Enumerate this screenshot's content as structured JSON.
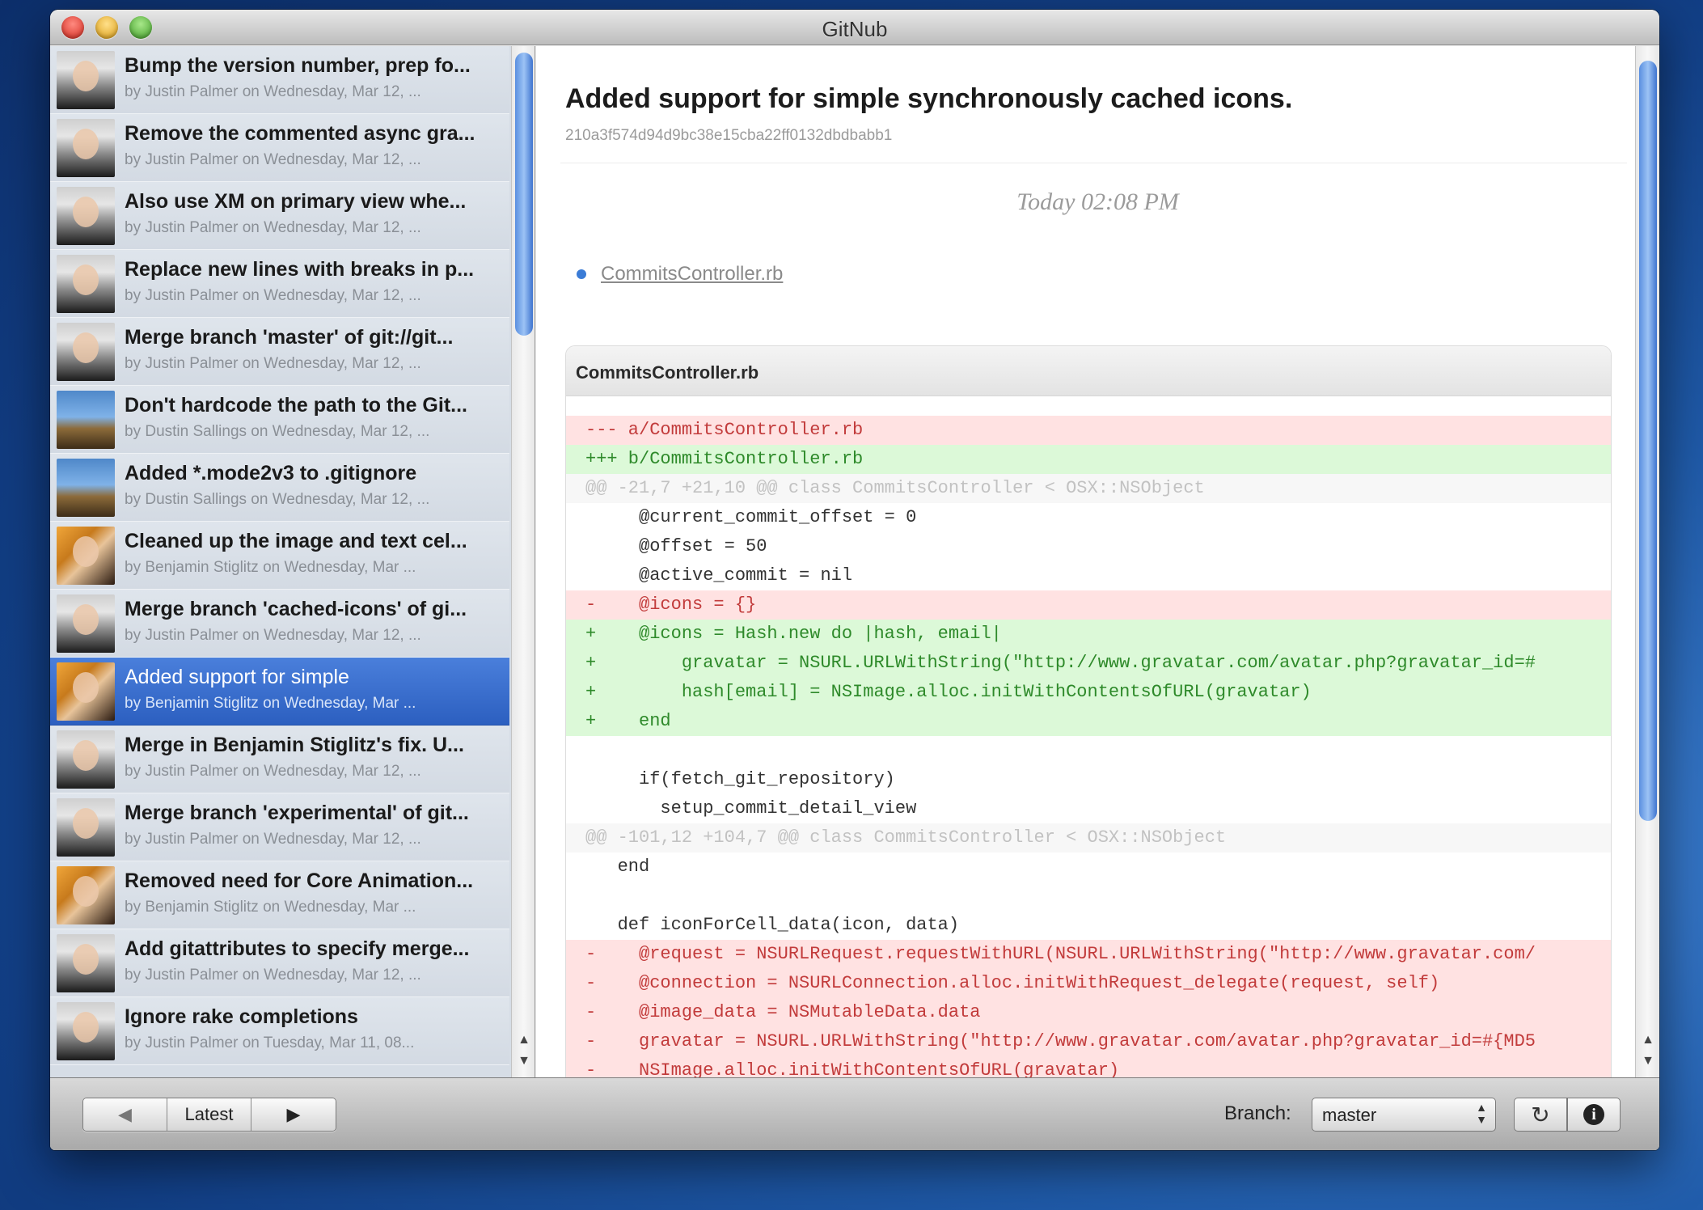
{
  "window": {
    "title": "GitNub"
  },
  "commits": [
    {
      "title": "Bump the version number, prep fo...",
      "sub": "by Justin Palmer on Wednesday, Mar 12, ...",
      "avatar": "justin"
    },
    {
      "title": "Remove the commented async gra...",
      "sub": "by Justin Palmer on Wednesday, Mar 12, ...",
      "avatar": "justin"
    },
    {
      "title": "Also use XM on primary view whe...",
      "sub": "by Justin Palmer on Wednesday, Mar 12, ...",
      "avatar": "justin"
    },
    {
      "title": "Replace new lines with breaks in p...",
      "sub": "by Justin Palmer on Wednesday, Mar 12, ...",
      "avatar": "justin"
    },
    {
      "title": "Merge branch 'master' of git://git...",
      "sub": "by Justin Palmer on Wednesday, Mar 12, ...",
      "avatar": "justin"
    },
    {
      "title": "Don't hardcode the path to the Git...",
      "sub": "by Dustin Sallings on Wednesday, Mar 12, ...",
      "avatar": "dustin"
    },
    {
      "title": "Added *.mode2v3 to .gitignore",
      "sub": "by Dustin Sallings on Wednesday, Mar 12, ...",
      "avatar": "dustin"
    },
    {
      "title": "Cleaned up the image and text cel...",
      "sub": "by Benjamin Stiglitz on Wednesday, Mar ...",
      "avatar": "benjamin"
    },
    {
      "title": "Merge branch 'cached-icons' of gi...",
      "sub": "by Justin Palmer on Wednesday, Mar 12, ...",
      "avatar": "justin"
    },
    {
      "title": "Added support for simple",
      "sub": "by Benjamin Stiglitz on Wednesday, Mar ...",
      "avatar": "benjamin",
      "selected": true
    },
    {
      "title": "Merge in Benjamin Stiglitz's fix. U...",
      "sub": "by Justin Palmer on Wednesday, Mar 12, ...",
      "avatar": "justin"
    },
    {
      "title": "Merge branch 'experimental' of git...",
      "sub": "by Justin Palmer on Wednesday, Mar 12, ...",
      "avatar": "justin"
    },
    {
      "title": "Removed need for Core Animation...",
      "sub": "by Benjamin Stiglitz on Wednesday, Mar ...",
      "avatar": "benjamin"
    },
    {
      "title": "Add gitattributes to specify merge...",
      "sub": "by Justin Palmer on Wednesday, Mar 12, ...",
      "avatar": "justin"
    },
    {
      "title": "Ignore rake completions",
      "sub": "by Justin Palmer on Tuesday, Mar 11, 08...",
      "avatar": "justin"
    }
  ],
  "detail": {
    "heading": "Added support for simple synchronously cached icons.",
    "sha": "210a3f574d94d9bc38e15cba22ff0132dbdbabb1",
    "date": "Today 02:08 PM",
    "file_link": "CommitsController.rb",
    "diff_header": "CommitsController.rb",
    "diff_lines": [
      {
        "type": "del",
        "text": "--- a/CommitsController.rb"
      },
      {
        "type": "add",
        "text": "+++ b/CommitsController.rb"
      },
      {
        "type": "hunk",
        "text": "@@ -21,7 +21,10 @@ class CommitsController < OSX::NSObject"
      },
      {
        "type": "ctx",
        "text": "     @current_commit_offset = 0"
      },
      {
        "type": "ctx",
        "text": "     @offset = 50"
      },
      {
        "type": "ctx",
        "text": "     @active_commit = nil"
      },
      {
        "type": "del",
        "text": "-    @icons = {}"
      },
      {
        "type": "add",
        "text": "+    @icons = Hash.new do |hash, email|"
      },
      {
        "type": "add",
        "text": "+        gravatar = NSURL.URLWithString(\"http://www.gravatar.com/avatar.php?gravatar_id=#"
      },
      {
        "type": "add",
        "text": "+        hash[email] = NSImage.alloc.initWithContentsOfURL(gravatar)"
      },
      {
        "type": "add",
        "text": "+    end"
      },
      {
        "type": "blank",
        "text": ""
      },
      {
        "type": "ctx",
        "text": "     if(fetch_git_repository)"
      },
      {
        "type": "ctx",
        "text": "       setup_commit_detail_view"
      },
      {
        "type": "hunk",
        "text": "@@ -101,12 +104,7 @@ class CommitsController < OSX::NSObject"
      },
      {
        "type": "ctx",
        "text": "   end"
      },
      {
        "type": "blank",
        "text": ""
      },
      {
        "type": "ctx",
        "text": "   def iconForCell_data(icon, data)"
      },
      {
        "type": "del",
        "text": "-    @request = NSURLRequest.requestWithURL(NSURL.URLWithString(\"http://www.gravatar.com/"
      },
      {
        "type": "del",
        "text": "-    @connection = NSURLConnection.alloc.initWithRequest_delegate(request, self)"
      },
      {
        "type": "del",
        "text": "-    @image_data = NSMutableData.data"
      },
      {
        "type": "del",
        "text": "-    gravatar = NSURL.URLWithString(\"http://www.gravatar.com/avatar.php?gravatar_id=#{MD5"
      },
      {
        "type": "del",
        "text": "-    NSImage.alloc.initWithContentsOfURL(gravatar)"
      }
    ]
  },
  "toolbar": {
    "prev_glyph": "◀",
    "latest_label": "Latest",
    "next_glyph": "▶",
    "branch_label": "Branch:",
    "branch_value": "master",
    "refresh_glyph": "↻",
    "info_glyph": "i"
  }
}
